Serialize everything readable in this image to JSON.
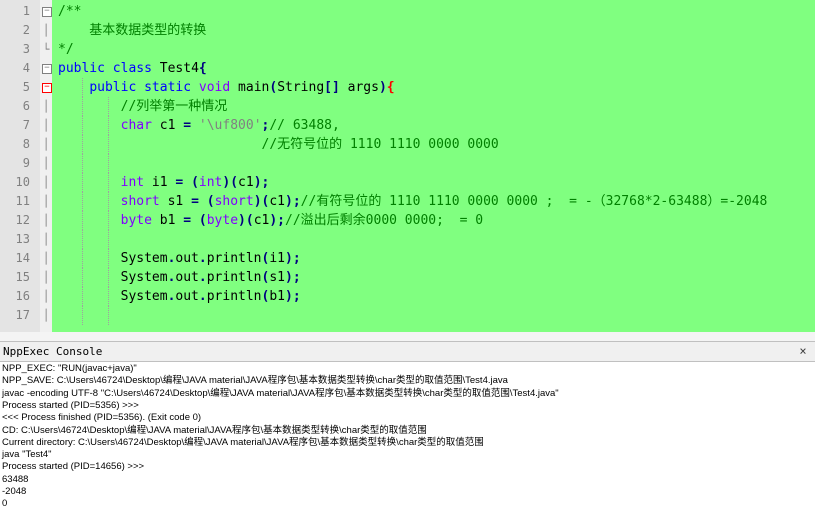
{
  "editor": {
    "background": "#80ff80",
    "lines": [
      {
        "n": "1",
        "fold": "box-minus",
        "tokens": [
          {
            "c": "cm",
            "t": "/**"
          }
        ]
      },
      {
        "n": "2",
        "fold": "line",
        "tokens": [
          {
            "c": "cm",
            "t": "    基本数据类型的转换"
          }
        ]
      },
      {
        "n": "3",
        "fold": "end",
        "tokens": [
          {
            "c": "cm",
            "t": "*/"
          }
        ]
      },
      {
        "n": "4",
        "fold": "box-minus",
        "tokens": [
          {
            "c": "kw",
            "t": "public"
          },
          {
            "c": "txt",
            "t": " "
          },
          {
            "c": "kw",
            "t": "class"
          },
          {
            "c": "txt",
            "t": " Test4"
          },
          {
            "c": "op",
            "t": "{"
          }
        ]
      },
      {
        "n": "5",
        "fold": "box-minus-red",
        "tokens": [
          {
            "c": "txt",
            "t": "    "
          },
          {
            "c": "kw",
            "t": "public"
          },
          {
            "c": "txt",
            "t": " "
          },
          {
            "c": "kw",
            "t": "static"
          },
          {
            "c": "txt",
            "t": " "
          },
          {
            "c": "typ",
            "t": "void"
          },
          {
            "c": "txt",
            "t": " main"
          },
          {
            "c": "op",
            "t": "("
          },
          {
            "c": "txt",
            "t": "String"
          },
          {
            "c": "op",
            "t": "[]"
          },
          {
            "c": "txt",
            "t": " args"
          },
          {
            "c": "op",
            "t": ")"
          },
          {
            "c": "brace-hl",
            "t": "{"
          }
        ]
      },
      {
        "n": "6",
        "fold": "line",
        "tokens": [
          {
            "c": "txt",
            "t": "        "
          },
          {
            "c": "cm",
            "t": "//列举第一种情况"
          }
        ]
      },
      {
        "n": "7",
        "fold": "line",
        "tokens": [
          {
            "c": "txt",
            "t": "        "
          },
          {
            "c": "typ",
            "t": "char"
          },
          {
            "c": "txt",
            "t": " c1 "
          },
          {
            "c": "op",
            "t": "="
          },
          {
            "c": "txt",
            "t": " "
          },
          {
            "c": "str",
            "t": "'\\uf800'"
          },
          {
            "c": "op",
            "t": ";"
          },
          {
            "c": "cm",
            "t": "// 63488,"
          }
        ]
      },
      {
        "n": "8",
        "fold": "line",
        "tokens": [
          {
            "c": "txt",
            "t": "                          "
          },
          {
            "c": "cm",
            "t": "//无符号位的 1110 1110 0000 0000"
          }
        ]
      },
      {
        "n": "9",
        "fold": "line",
        "tokens": []
      },
      {
        "n": "10",
        "fold": "line",
        "tokens": [
          {
            "c": "txt",
            "t": "        "
          },
          {
            "c": "typ",
            "t": "int"
          },
          {
            "c": "txt",
            "t": " i1 "
          },
          {
            "c": "op",
            "t": "="
          },
          {
            "c": "txt",
            "t": " "
          },
          {
            "c": "op",
            "t": "("
          },
          {
            "c": "typ",
            "t": "int"
          },
          {
            "c": "op",
            "t": ")("
          },
          {
            "c": "txt",
            "t": "c1"
          },
          {
            "c": "op",
            "t": ");"
          }
        ]
      },
      {
        "n": "11",
        "fold": "line",
        "tokens": [
          {
            "c": "txt",
            "t": "        "
          },
          {
            "c": "typ",
            "t": "short"
          },
          {
            "c": "txt",
            "t": " s1 "
          },
          {
            "c": "op",
            "t": "="
          },
          {
            "c": "txt",
            "t": " "
          },
          {
            "c": "op",
            "t": "("
          },
          {
            "c": "typ",
            "t": "short"
          },
          {
            "c": "op",
            "t": ")("
          },
          {
            "c": "txt",
            "t": "c1"
          },
          {
            "c": "op",
            "t": ");"
          },
          {
            "c": "cm",
            "t": "//有符号位的 1110 1110 0000 0000 ;  = -（32768*2-63488）=-2048"
          }
        ]
      },
      {
        "n": "12",
        "fold": "line",
        "tokens": [
          {
            "c": "txt",
            "t": "        "
          },
          {
            "c": "typ",
            "t": "byte"
          },
          {
            "c": "txt",
            "t": " b1 "
          },
          {
            "c": "op",
            "t": "="
          },
          {
            "c": "txt",
            "t": " "
          },
          {
            "c": "op",
            "t": "("
          },
          {
            "c": "typ",
            "t": "byte"
          },
          {
            "c": "op",
            "t": ")("
          },
          {
            "c": "txt",
            "t": "c1"
          },
          {
            "c": "op",
            "t": ");"
          },
          {
            "c": "cm",
            "t": "//溢出后剩余0000 0000;  = 0"
          }
        ]
      },
      {
        "n": "13",
        "fold": "line",
        "tokens": []
      },
      {
        "n": "14",
        "fold": "line",
        "tokens": [
          {
            "c": "txt",
            "t": "        System"
          },
          {
            "c": "op",
            "t": "."
          },
          {
            "c": "txt",
            "t": "out"
          },
          {
            "c": "op",
            "t": "."
          },
          {
            "c": "txt",
            "t": "println"
          },
          {
            "c": "op",
            "t": "("
          },
          {
            "c": "txt",
            "t": "i1"
          },
          {
            "c": "op",
            "t": ");"
          }
        ]
      },
      {
        "n": "15",
        "fold": "line",
        "tokens": [
          {
            "c": "txt",
            "t": "        System"
          },
          {
            "c": "op",
            "t": "."
          },
          {
            "c": "txt",
            "t": "out"
          },
          {
            "c": "op",
            "t": "."
          },
          {
            "c": "txt",
            "t": "println"
          },
          {
            "c": "op",
            "t": "("
          },
          {
            "c": "txt",
            "t": "s1"
          },
          {
            "c": "op",
            "t": ");"
          }
        ]
      },
      {
        "n": "16",
        "fold": "line",
        "tokens": [
          {
            "c": "txt",
            "t": "        System"
          },
          {
            "c": "op",
            "t": "."
          },
          {
            "c": "txt",
            "t": "out"
          },
          {
            "c": "op",
            "t": "."
          },
          {
            "c": "txt",
            "t": "println"
          },
          {
            "c": "op",
            "t": "("
          },
          {
            "c": "txt",
            "t": "b1"
          },
          {
            "c": "op",
            "t": ");"
          }
        ]
      },
      {
        "n": "17",
        "fold": "line",
        "tokens": []
      }
    ]
  },
  "console": {
    "title": "NppExec Console",
    "close_icon": "×",
    "lines": [
      "NPP_EXEC: \"RUN(javac+java)\"",
      "NPP_SAVE: C:\\Users\\46724\\Desktop\\编程\\JAVA material\\JAVA程序包\\基本数据类型转换\\char类型的取值范围\\Test4.java",
      "javac -encoding UTF-8 \"C:\\Users\\46724\\Desktop\\编程\\JAVA material\\JAVA程序包\\基本数据类型转换\\char类型的取值范围\\Test4.java\"",
      "Process started (PID=5356) >>>",
      "<<< Process finished (PID=5356). (Exit code 0)",
      "CD: C:\\Users\\46724\\Desktop\\编程\\JAVA material\\JAVA程序包\\基本数据类型转换\\char类型的取值范围",
      "Current directory: C:\\Users\\46724\\Desktop\\编程\\JAVA material\\JAVA程序包\\基本数据类型转换\\char类型的取值范围",
      "java \"Test4\"",
      "Process started (PID=14656) >>>",
      "63488",
      "-2048",
      "0"
    ]
  }
}
